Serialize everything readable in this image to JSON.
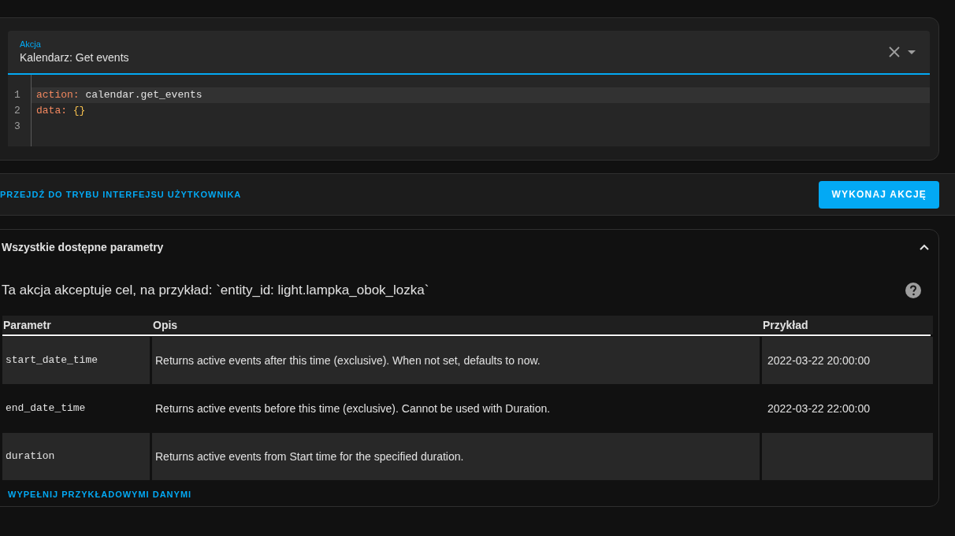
{
  "action_field": {
    "label": "Akcja",
    "value": "Kalendarz: Get events"
  },
  "code": {
    "lines": [
      {
        "number": "1",
        "highlighted": true,
        "tokens": [
          {
            "kind": "key",
            "text": "action:"
          },
          {
            "kind": "plain",
            "text": "calendar.get_events"
          }
        ]
      },
      {
        "number": "2",
        "highlighted": false,
        "tokens": [
          {
            "kind": "key",
            "text": "data:"
          },
          {
            "kind": "bracket",
            "text": "{}"
          }
        ]
      },
      {
        "number": "3",
        "highlighted": false
      }
    ]
  },
  "toolbar": {
    "mode_link": "PRZEJDŹ DO TRYBU INTERFEJSU UŻYTKOWNIKA",
    "run_button": "WYKONAJ AKCJĘ"
  },
  "parameters_panel": {
    "title": "Wszystkie dostępne parametry",
    "expanded": true,
    "target_note": "Ta akcja akceptuje cel, na przykład: `entity_id: light.lampka_obok_lozka`",
    "table": {
      "columns": [
        "Parametr",
        "Opis",
        "Przykład"
      ],
      "rows": [
        {
          "parameter": "start_date_time",
          "description": "Returns active events after this time (exclusive). When not set, defaults to now.",
          "example": "2022-03-22 20:00:00"
        },
        {
          "parameter": "end_date_time",
          "description": "Returns active events before this time (exclusive). Cannot be used with Duration.",
          "example": "2022-03-22 22:00:00"
        },
        {
          "parameter": "duration",
          "description": "Returns active events from Start time for the specified duration."
        }
      ]
    },
    "fill_link": "WYPEŁNIJ PRZYKŁADOWYMI DANYMI"
  }
}
